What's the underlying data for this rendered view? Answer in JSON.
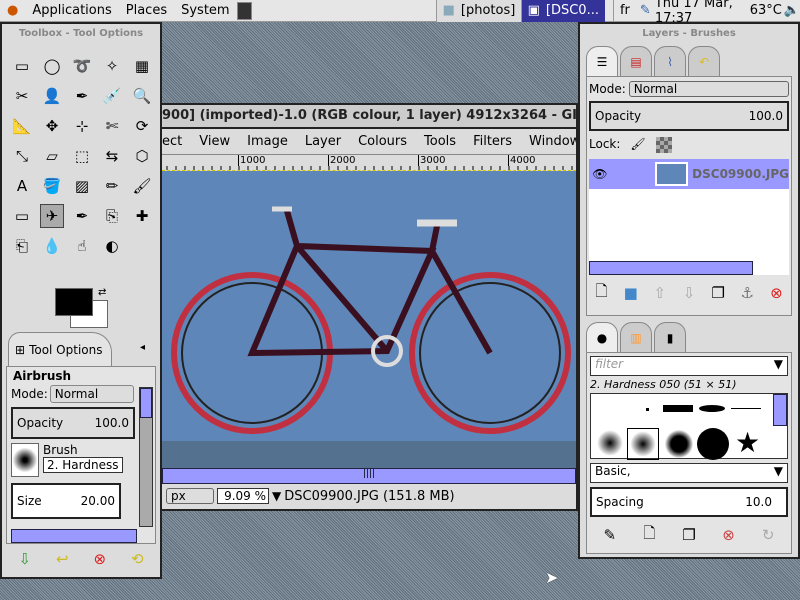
{
  "panel": {
    "applications": "Applications",
    "places": "Places",
    "system": "System",
    "tasks": [
      "[photos]",
      "[DSC0..."
    ],
    "keyboard": "fr",
    "clock": "Thu 17 Mar, 17:37",
    "temp": "63°C"
  },
  "toolbox": {
    "title": "Toolbox - Tool Options",
    "tab": "Tool Options",
    "tool_name": "Airbrush",
    "mode_label": "Mode:",
    "mode": "Normal",
    "opacity_label": "Opacity",
    "opacity": "100.0",
    "brush_label": "Brush",
    "brush": "2. Hardness",
    "size_label": "Size",
    "size": "20.00",
    "tools": [
      "rect-select",
      "ellipse-select",
      "free-select",
      "fuzzy-select",
      "by-color-select",
      "scissors",
      "foreground-select",
      "paths",
      "color-picker",
      "zoom",
      "measure",
      "move",
      "align",
      "crop",
      "rotate",
      "scale",
      "shear",
      "perspective",
      "flip",
      "cage",
      "text",
      "bucket-fill",
      "blend",
      "pencil",
      "paintbrush",
      "eraser",
      "airbrush",
      "ink",
      "clone",
      "heal",
      "perspective-clone",
      "blur",
      "smudge",
      "dodge-burn"
    ],
    "fg_color": "#000000",
    "bg_color": "#ffffff"
  },
  "image": {
    "title": "900] (imported)-1.0 (RGB colour, 1 layer) 4912x3264 - GI",
    "menu": [
      "ect",
      "View",
      "Image",
      "Layer",
      "Colours",
      "Tools",
      "Filters",
      "Windows"
    ],
    "ruler": [
      "1000",
      "2000",
      "3000",
      "4000"
    ],
    "unit": "px",
    "zoom": "9.09 %",
    "status": "DSC09900.JPG (151.8 MB)"
  },
  "layers": {
    "title": "Layers - Brushes",
    "mode_label": "Mode:",
    "mode": "Normal",
    "opacity_label": "Opacity",
    "opacity": "100.0",
    "lock_label": "Lock:",
    "layer_name": "DSC09900.JPG",
    "filter_placeholder": "filter",
    "brush_name": "2. Hardness 050 (51 × 51)",
    "brush_set": "Basic,",
    "spacing_label": "Spacing",
    "spacing": "10.0"
  },
  "colors": {
    "selection": "#9999ff",
    "active_task": "#33339a"
  }
}
